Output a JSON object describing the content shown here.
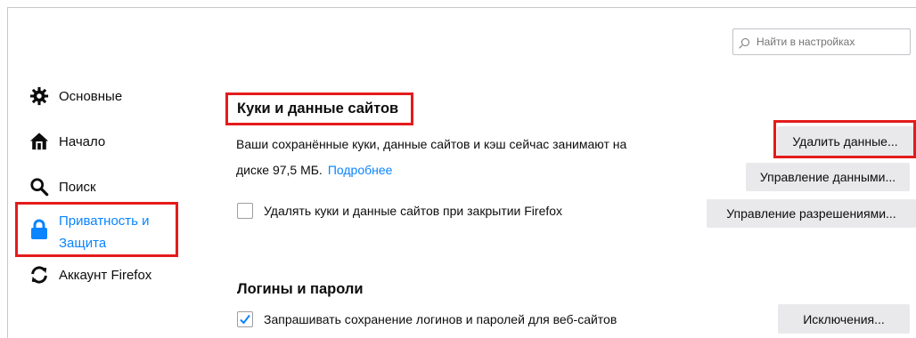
{
  "search": {
    "placeholder": "Найти в настройках",
    "icon": "search-icon"
  },
  "sidebar": {
    "items": [
      {
        "label": "Основные",
        "icon": "gear-icon"
      },
      {
        "label": "Начало",
        "icon": "home-icon"
      },
      {
        "label": "Поиск",
        "icon": "search-icon"
      },
      {
        "label": "Приватность и Защита",
        "label_line1": "Приватность и",
        "label_line2": "Защита",
        "icon": "lock-icon",
        "active": true
      },
      {
        "label": "Аккаунт Firefox",
        "icon": "sync-icon"
      }
    ]
  },
  "cookies": {
    "heading": "Куки и данные сайтов",
    "description_line1": "Ваши сохранённые куки, данные сайтов и кэш сейчас занимают на",
    "description_line2": "диске 97,5 МБ.",
    "learn_more": "Подробнее",
    "clear_data_button": "Удалить данные...",
    "manage_data_button": "Управление данными...",
    "delete_on_close_label": "Удалять куки и данные сайтов при закрытии Firefox",
    "delete_on_close_checked": false,
    "manage_permissions_button": "Управление разрешениями..."
  },
  "logins": {
    "heading": "Логины и пароли",
    "ask_to_save_label": "Запрашивать сохранение логинов и паролей для веб-сайтов",
    "ask_to_save_checked": true,
    "exceptions_button": "Исключения..."
  },
  "colors": {
    "accent": "#0a84ff",
    "highlight_box": "#e41b1b",
    "button_bg": "#e9e9ec"
  }
}
